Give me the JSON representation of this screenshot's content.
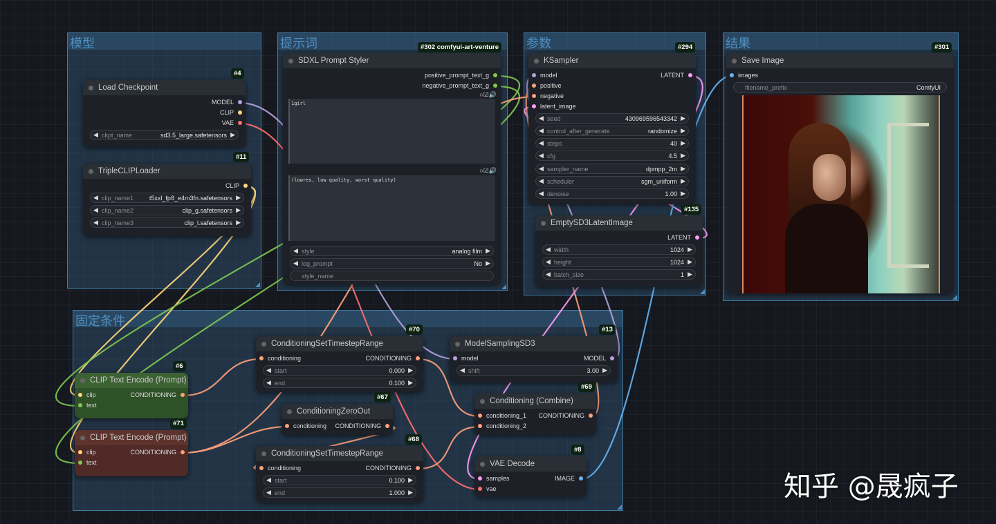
{
  "slot_colors": {
    "MODEL": "#b7a3e0",
    "CLIP": "#ffd67a",
    "VAE": "#ff6e6e",
    "CONDITIONING": "#ffa07a",
    "LATENT": "#ff9cf9",
    "IMAGE": "#64b5f6",
    "STRING": "#7ec850",
    "INT": "#888888"
  },
  "groups": [
    {
      "title": "模型"
    },
    {
      "title": "提示词"
    },
    {
      "title": "参数"
    },
    {
      "title": "结果"
    },
    {
      "title": "固定条件"
    }
  ],
  "nodes": [
    {
      "id": "#4",
      "title": "Load Checkpoint",
      "inputs": [],
      "outputs": [
        {
          "name": "MODEL",
          "type": "MODEL"
        },
        {
          "name": "CLIP",
          "type": "CLIP"
        },
        {
          "name": "VAE",
          "type": "VAE"
        }
      ],
      "widgets": [
        {
          "label": "ckpt_name",
          "value": "sd3.5_large.safetensors"
        }
      ]
    },
    {
      "id": "#11",
      "title": "TripleCLIPLoader",
      "inputs": [],
      "outputs": [
        {
          "name": "CLIP",
          "type": "CLIP"
        }
      ],
      "widgets": [
        {
          "label": "clip_name1",
          "value": "t5xxl_fp8_e4m3fn.safetensors"
        },
        {
          "label": "clip_name2",
          "value": "clip_g.safetensors"
        },
        {
          "label": "clip_name3",
          "value": "clip_l.safetensors"
        }
      ]
    },
    {
      "id": "#302 comfyui-art-venture",
      "title": "SDXL Prompt Styler",
      "inputs": [],
      "outputs": [
        {
          "name": "positive_prompt_text_g",
          "type": "STRING"
        },
        {
          "name": "negative_prompt_text_g",
          "type": "STRING"
        }
      ],
      "textareas": [
        "1girl",
        "(lowres, low quality, worst quality)"
      ],
      "widgets": [
        {
          "label": "style",
          "value": "analog film"
        },
        {
          "label": "log_prompt",
          "value": "No"
        },
        {
          "label": "style_name",
          "value": ""
        }
      ]
    },
    {
      "id": "#294",
      "title": "KSampler",
      "inputs": [
        {
          "name": "model",
          "type": "MODEL"
        },
        {
          "name": "positive",
          "type": "CONDITIONING"
        },
        {
          "name": "negative",
          "type": "CONDITIONING"
        },
        {
          "name": "latent_image",
          "type": "LATENT"
        }
      ],
      "outputs": [
        {
          "name": "LATENT",
          "type": "LATENT"
        }
      ],
      "widgets": [
        {
          "label": "seed",
          "value": "430969596543342"
        },
        {
          "label": "control_after_generate",
          "value": "randomize"
        },
        {
          "label": "steps",
          "value": "40"
        },
        {
          "label": "cfg",
          "value": "4.5"
        },
        {
          "label": "sampler_name",
          "value": "dpmpp_2m"
        },
        {
          "label": "scheduler",
          "value": "sgm_uniform"
        },
        {
          "label": "denoise",
          "value": "1.00"
        }
      ]
    },
    {
      "id": "#135",
      "title": "EmptySD3LatentImage",
      "inputs": [],
      "outputs": [
        {
          "name": "LATENT",
          "type": "LATENT"
        }
      ],
      "widgets": [
        {
          "label": "width",
          "value": "1024"
        },
        {
          "label": "height",
          "value": "1024"
        },
        {
          "label": "batch_size",
          "value": "1"
        }
      ]
    },
    {
      "id": "#301",
      "title": "Save Image",
      "inputs": [
        {
          "name": "images",
          "type": "IMAGE"
        }
      ],
      "outputs": [],
      "widgets": [
        {
          "label": "filename_prefix",
          "value": "ComfyUI"
        }
      ]
    },
    {
      "id": "#6",
      "title": "CLIP Text Encode (Prompt)",
      "color": "#2f5128",
      "title_color": "#3c6234",
      "inputs": [
        {
          "name": "clip",
          "type": "CLIP"
        },
        {
          "name": "text",
          "type": "STRING"
        }
      ],
      "outputs": [
        {
          "name": "CONDITIONING",
          "type": "CONDITIONING"
        }
      ],
      "widgets": []
    },
    {
      "id": "#71",
      "title": "CLIP Text Encode (Prompt)",
      "color": "#4f2a26",
      "title_color": "#5e332e",
      "inputs": [
        {
          "name": "clip",
          "type": "CLIP"
        },
        {
          "name": "text",
          "type": "STRING"
        }
      ],
      "outputs": [
        {
          "name": "CONDITIONING",
          "type": "CONDITIONING"
        }
      ],
      "widgets": []
    },
    {
      "id": "#70",
      "title": "ConditioningSetTimestepRange",
      "inputs": [
        {
          "name": "conditioning",
          "type": "CONDITIONING"
        }
      ],
      "outputs": [
        {
          "name": "CONDITIONING",
          "type": "CONDITIONING"
        }
      ],
      "widgets": [
        {
          "label": "start",
          "value": "0.000"
        },
        {
          "label": "end",
          "value": "0.100"
        }
      ]
    },
    {
      "id": "#67",
      "title": "ConditioningZeroOut",
      "inputs": [
        {
          "name": "conditioning",
          "type": "CONDITIONING"
        }
      ],
      "outputs": [
        {
          "name": "CONDITIONING",
          "type": "CONDITIONING"
        }
      ],
      "widgets": []
    },
    {
      "id": "#68",
      "title": "ConditioningSetTimestepRange",
      "inputs": [
        {
          "name": "conditioning",
          "type": "CONDITIONING"
        }
      ],
      "outputs": [
        {
          "name": "CONDITIONING",
          "type": "CONDITIONING"
        }
      ],
      "widgets": [
        {
          "label": "start",
          "value": "0.100"
        },
        {
          "label": "end",
          "value": "1.000"
        }
      ]
    },
    {
      "id": "#13",
      "title": "ModelSamplingSD3",
      "inputs": [
        {
          "name": "model",
          "type": "MODEL"
        }
      ],
      "outputs": [
        {
          "name": "MODEL",
          "type": "MODEL"
        }
      ],
      "widgets": [
        {
          "label": "shift",
          "value": "3.00"
        }
      ]
    },
    {
      "id": "#69",
      "title": "Conditioning (Combine)",
      "inputs": [
        {
          "name": "conditioning_1",
          "type": "CONDITIONING"
        },
        {
          "name": "conditioning_2",
          "type": "CONDITIONING"
        }
      ],
      "outputs": [
        {
          "name": "CONDITIONING",
          "type": "CONDITIONING"
        }
      ],
      "widgets": []
    },
    {
      "id": "#8",
      "title": "VAE Decode",
      "inputs": [
        {
          "name": "samples",
          "type": "LATENT"
        },
        {
          "name": "vae",
          "type": "VAE"
        }
      ],
      "outputs": [
        {
          "name": "IMAGE",
          "type": "IMAGE"
        }
      ],
      "widgets": []
    }
  ],
  "watermark": "知乎 @晟疯子"
}
